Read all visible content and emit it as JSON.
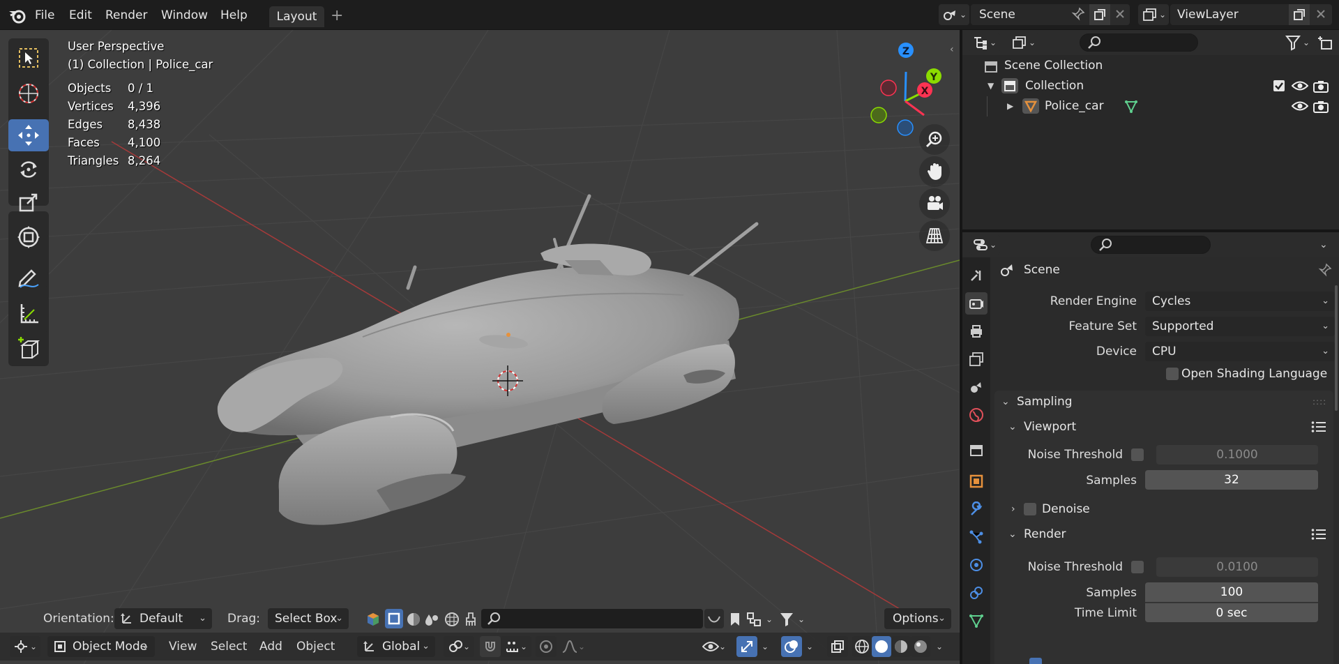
{
  "menu": {
    "items": [
      "File",
      "Edit",
      "Render",
      "Window",
      "Help"
    ],
    "workspace_tab": "Layout",
    "add_tab": "+",
    "scene_name": "Scene",
    "view_layer": "ViewLayer"
  },
  "viewport": {
    "view_name": "User Perspective",
    "collection_info": "(1) Collection | Police_car",
    "stats": [
      {
        "label": "Objects",
        "value": "0 / 1"
      },
      {
        "label": "Vertices",
        "value": "4,396"
      },
      {
        "label": "Edges",
        "value": "8,438"
      },
      {
        "label": "Faces",
        "value": "4,100"
      },
      {
        "label": "Triangles",
        "value": "8,264"
      }
    ],
    "gizmo": {
      "z": "Z",
      "y": "Y",
      "x": "X"
    },
    "tool_header": {
      "orientation_label": "Orientation:",
      "orientation_value": "Default",
      "drag_label": "Drag:",
      "drag_value": "Select Box",
      "options_label": "Options"
    },
    "header": {
      "mode": "Object Mode",
      "menus": [
        "View",
        "Select",
        "Add",
        "Object"
      ],
      "transform_orientation": "Global"
    }
  },
  "outliner": {
    "scene_collection": "Scene Collection",
    "collection": "Collection",
    "object": "Police_car"
  },
  "properties": {
    "context_title": "Scene",
    "render_engine_label": "Render Engine",
    "render_engine_value": "Cycles",
    "feature_set_label": "Feature Set",
    "feature_set_value": "Supported",
    "device_label": "Device",
    "device_value": "CPU",
    "osl_label": "Open Shading Language",
    "sampling": {
      "title": "Sampling",
      "viewport": {
        "title": "Viewport",
        "noise_threshold_label": "Noise Threshold",
        "noise_threshold_value": "0.1000",
        "samples_label": "Samples",
        "samples_value": "32",
        "denoise_label": "Denoise"
      },
      "render": {
        "title": "Render",
        "noise_threshold_label": "Noise Threshold",
        "noise_threshold_value": "0.0100",
        "samples_label": "Samples",
        "samples_value": "100",
        "time_limit_label": "Time Limit",
        "time_limit_value": "0 sec"
      }
    }
  },
  "colors": {
    "accent": "#4772b3",
    "axis_x": "#ff3352",
    "axis_y": "#8bdc00",
    "axis_z": "#2890ff",
    "object_orange": "#e6913c"
  }
}
